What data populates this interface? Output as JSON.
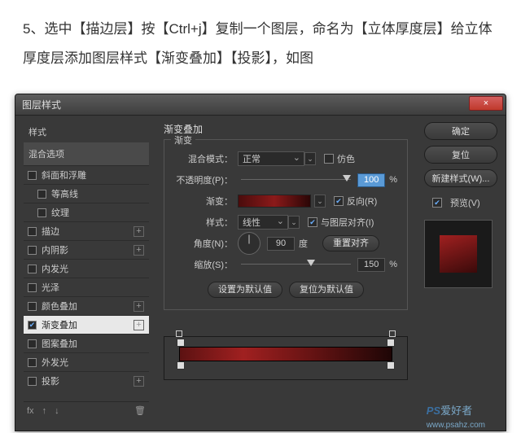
{
  "instruction": "5、选中【描边层】按【Ctrl+j】复制一个图层，命名为【立体厚度层】给立体厚度层添加图层样式【渐变叠加】【投影】，如图",
  "dialog": {
    "title": "图层样式",
    "close": "×"
  },
  "left": {
    "head": "样式",
    "blend": "混合选项",
    "items": [
      {
        "label": "斜面和浮雕",
        "checked": false,
        "plus": false
      },
      {
        "label": "等高线",
        "checked": false,
        "plus": false,
        "indent": true
      },
      {
        "label": "纹理",
        "checked": false,
        "plus": false,
        "indent": true
      },
      {
        "label": "描边",
        "checked": false,
        "plus": true
      },
      {
        "label": "内阴影",
        "checked": false,
        "plus": true
      },
      {
        "label": "内发光",
        "checked": false,
        "plus": false
      },
      {
        "label": "光泽",
        "checked": false,
        "plus": false
      },
      {
        "label": "颜色叠加",
        "checked": false,
        "plus": true
      },
      {
        "label": "渐变叠加",
        "checked": true,
        "plus": true,
        "selected": true
      },
      {
        "label": "图案叠加",
        "checked": false,
        "plus": false
      },
      {
        "label": "外发光",
        "checked": false,
        "plus": false
      },
      {
        "label": "投影",
        "checked": false,
        "plus": true
      }
    ],
    "tools": {
      "fx": "fx",
      "trash": "🗑"
    }
  },
  "center": {
    "section": "渐变叠加",
    "legend": "渐变",
    "blendMode": {
      "label": "混合模式：",
      "value": "正常",
      "dither": "仿色"
    },
    "opacity": {
      "label": "不透明度(P)：",
      "value": "100",
      "pct": "%"
    },
    "gradient": {
      "label": "渐变：",
      "reverse": "反向(R)"
    },
    "style": {
      "label": "样式：",
      "value": "线性",
      "align": "与图层对齐(I)"
    },
    "angle": {
      "label": "角度(N)：",
      "value": "90",
      "deg": "度",
      "reset": "重置对齐"
    },
    "scale": {
      "label": "缩放(S)：",
      "value": "150",
      "pct": "%"
    },
    "btnDefault": "设置为默认值",
    "btnReset": "复位为默认值"
  },
  "right": {
    "ok": "确定",
    "cancel": "复位",
    "newStyle": "新建样式(W)...",
    "preview": "预览(V)"
  },
  "watermark": {
    "brand": "PS",
    "text": "爱好者",
    "url": "www.psahz.com"
  }
}
